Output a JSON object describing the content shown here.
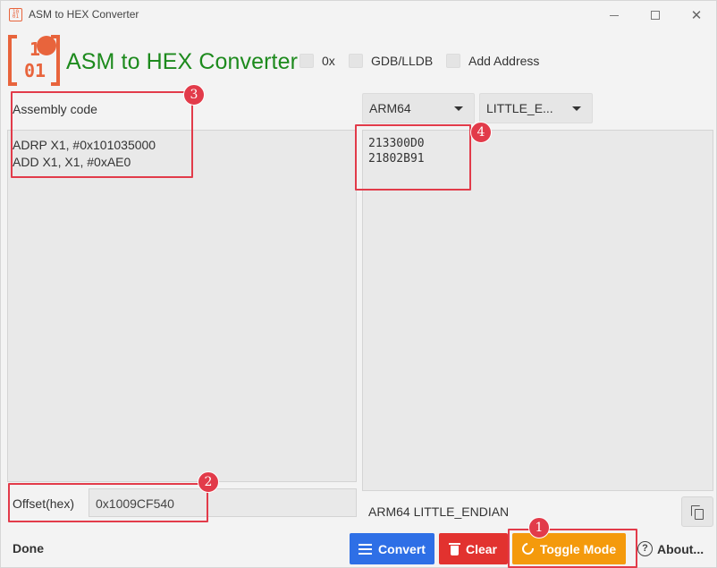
{
  "window": {
    "title": "ASM to HEX Converter"
  },
  "header": {
    "logo_digits": "10\n01",
    "title": "ASM to HEX Converter",
    "options": [
      {
        "label": "0x",
        "checked": false
      },
      {
        "label": "GDB/LLDB",
        "checked": false
      },
      {
        "label": "Add Address",
        "checked": false
      }
    ]
  },
  "left": {
    "label": "Assembly code",
    "code": "ADRP X1, #0x101035000\nADD X1, X1, #0xAE0",
    "offset_label": "Offset(hex)",
    "offset_value": "0x1009CF540",
    "status": "Done"
  },
  "right": {
    "arch": "ARM64",
    "endian": "LITTLE_E...",
    "hex": "213300D0\n21802B91",
    "mode_label": "ARM64 LITTLE_ENDIAN"
  },
  "buttons": {
    "convert": "Convert",
    "clear": "Clear",
    "toggle": "Toggle Mode",
    "about": "About..."
  },
  "annotations": [
    "1",
    "2",
    "3",
    "4"
  ],
  "colors": {
    "title_green": "#1d8a1d",
    "logo_orange": "#e8643c",
    "convert_blue": "#2e6fe6",
    "clear_red": "#e2322f",
    "toggle_orange": "#f49a0c",
    "annotation_red": "#e23b4a"
  }
}
